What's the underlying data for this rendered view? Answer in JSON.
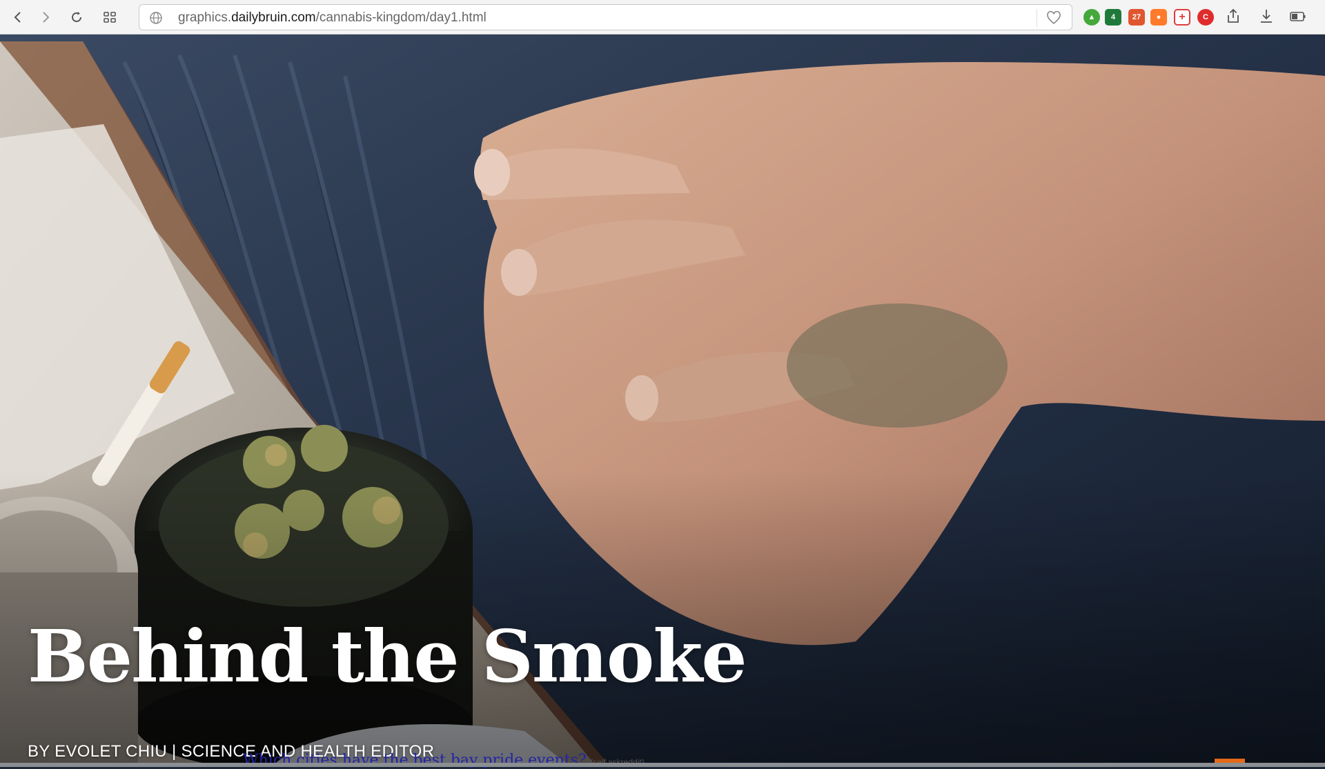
{
  "browser": {
    "url_prefix": "graphics.",
    "url_host": "dailybruin.com",
    "url_path": "/cannabis-kingdom/day1.html",
    "extensions": {
      "sheet_badge": "4",
      "calendar_badge": "27",
      "red_label": "C"
    }
  },
  "hero": {
    "title": "Behind the Smoke",
    "byline": "BY EVOLET CHIU | SCIENCE AND HEALTH EDITOR"
  },
  "below_fold": {
    "link_text": "Which cities have the best bay pride events?",
    "small_text": "(self.askreddit)"
  }
}
